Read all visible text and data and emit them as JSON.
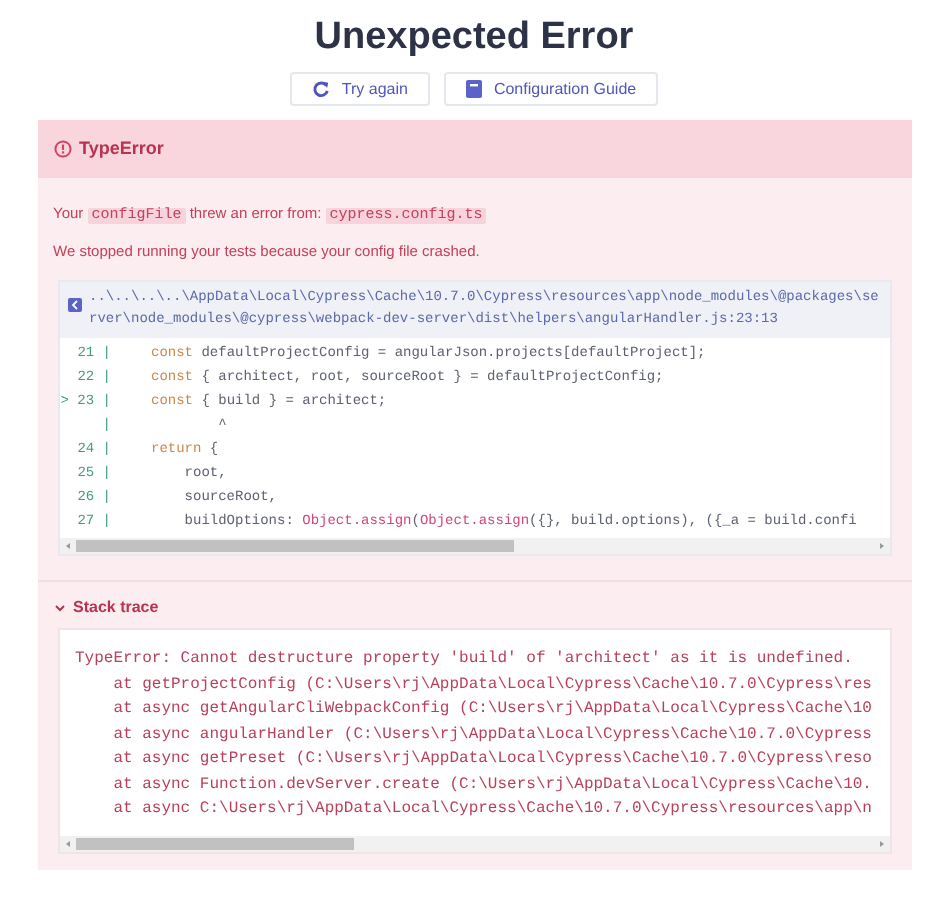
{
  "title": "Unexpected Error",
  "buttons": [
    {
      "kind": "retry",
      "label": "Try again"
    },
    {
      "kind": "guide",
      "label": "Configuration Guide"
    }
  ],
  "error": {
    "name": "TypeError",
    "message": [
      {
        "text": "Your ",
        "code": false
      },
      {
        "text": "configFile",
        "code": true
      },
      {
        "text": " threw an error from: ",
        "code": false
      },
      {
        "text": "cypress.config.ts",
        "code": true
      }
    ],
    "detail": "We stopped running your tests because your config file crashed.",
    "file_path": "..\\..\\..\\..\\AppData\\Local\\Cypress\\Cache\\10.7.0\\Cypress\\resources\\app\\node_modules\\@packages\\server\\node_modules\\@cypress\\webpack-dev-server\\dist\\helpers\\angularHandler.js:23:13",
    "code_lines": [
      {
        "gutter": "21 |",
        "tokens": [
          {
            "kind": "keyword",
            "text": "const"
          },
          {
            "kind": "plain",
            "text": " defaultProjectConfig = angularJson.projects[defaultProject];"
          }
        ]
      },
      {
        "gutter": "22 |",
        "tokens": [
          {
            "kind": "keyword",
            "text": "const"
          },
          {
            "kind": "plain",
            "text": " { architect, root, sourceRoot } = defaultProjectConfig;"
          }
        ]
      },
      {
        "gutter": "> 23 |",
        "tokens": [
          {
            "kind": "keyword",
            "text": "const"
          },
          {
            "kind": "plain",
            "text": " { build } = architect;"
          }
        ]
      },
      {
        "gutter": "|",
        "tokens": [
          {
            "kind": "plain",
            "text": "        ^"
          }
        ]
      },
      {
        "gutter": "24 |",
        "tokens": [
          {
            "kind": "keyword",
            "text": "return"
          },
          {
            "kind": "plain",
            "text": " {"
          }
        ]
      },
      {
        "gutter": "25 |",
        "tokens": [
          {
            "kind": "plain",
            "text": "    root,"
          }
        ]
      },
      {
        "gutter": "26 |",
        "tokens": [
          {
            "kind": "plain",
            "text": "    sourceRoot,"
          }
        ]
      },
      {
        "gutter": "27 |",
        "tokens": [
          {
            "kind": "plain",
            "text": "    buildOptions: "
          },
          {
            "kind": "builtin",
            "text": "Object.assign"
          },
          {
            "kind": "plain",
            "text": "("
          },
          {
            "kind": "builtin",
            "text": "Object.assign"
          },
          {
            "kind": "plain",
            "text": "({}, build.options), ({_a = build.confi"
          }
        ]
      }
    ],
    "stack_trace": {
      "title": "Stack trace",
      "expanded": true,
      "lines": [
        "TypeError: Cannot destructure property 'build' of 'architect' as it is undefined.",
        "    at getProjectConfig (C:\\Users\\rj\\AppData\\Local\\Cypress\\Cache\\10.7.0\\Cypress\\res",
        "    at async getAngularCliWebpackConfig (C:\\Users\\rj\\AppData\\Local\\Cypress\\Cache\\10",
        "    at async angularHandler (C:\\Users\\rj\\AppData\\Local\\Cypress\\Cache\\10.7.0\\Cypress",
        "    at async getPreset (C:\\Users\\rj\\AppData\\Local\\Cypress\\Cache\\10.7.0\\Cypress\\reso",
        "    at async Function.devServer.create (C:\\Users\\rj\\AppData\\Local\\Cypress\\Cache\\10.",
        "    at async C:\\Users\\rj\\AppData\\Local\\Cypress\\Cache\\10.7.0\\Cypress\\resources\\app\\n"
      ]
    }
  }
}
